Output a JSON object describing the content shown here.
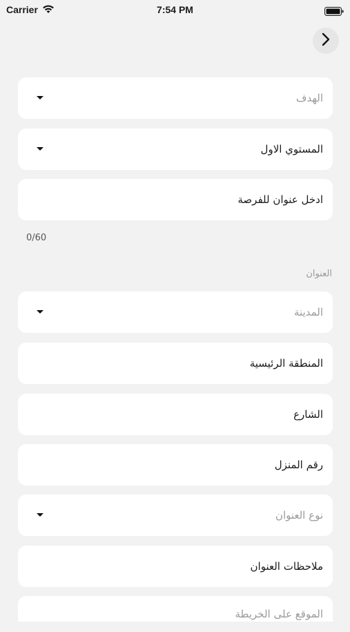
{
  "status_bar": {
    "carrier": "Carrier",
    "time": "7:54 PM"
  },
  "header": {
    "back_icon": "chevron-right-icon"
  },
  "form": {
    "goal_select": {
      "placeholder": "الهدف"
    },
    "level_select": {
      "value": "المستوي الاول"
    },
    "title_input": {
      "placeholder": "ادخل عنوان للفرصة",
      "counter": "0/60"
    },
    "address_section_label": "العنوان",
    "city_select": {
      "placeholder": "المدينة"
    },
    "main_area_input": {
      "placeholder": "المنطقة الرئيسية"
    },
    "street_input": {
      "placeholder": "الشارع"
    },
    "house_number_input": {
      "placeholder": "رقم المنزل"
    },
    "address_type_select": {
      "placeholder": "نوع العنوان"
    },
    "address_notes_input": {
      "placeholder": "ملاحظات العنوان"
    },
    "map_location_input": {
      "placeholder": "الموقع على الخريطة"
    }
  },
  "colors": {
    "background": "#f2f2f2",
    "field_background": "#ffffff",
    "placeholder_text": "#9a9a9a"
  }
}
